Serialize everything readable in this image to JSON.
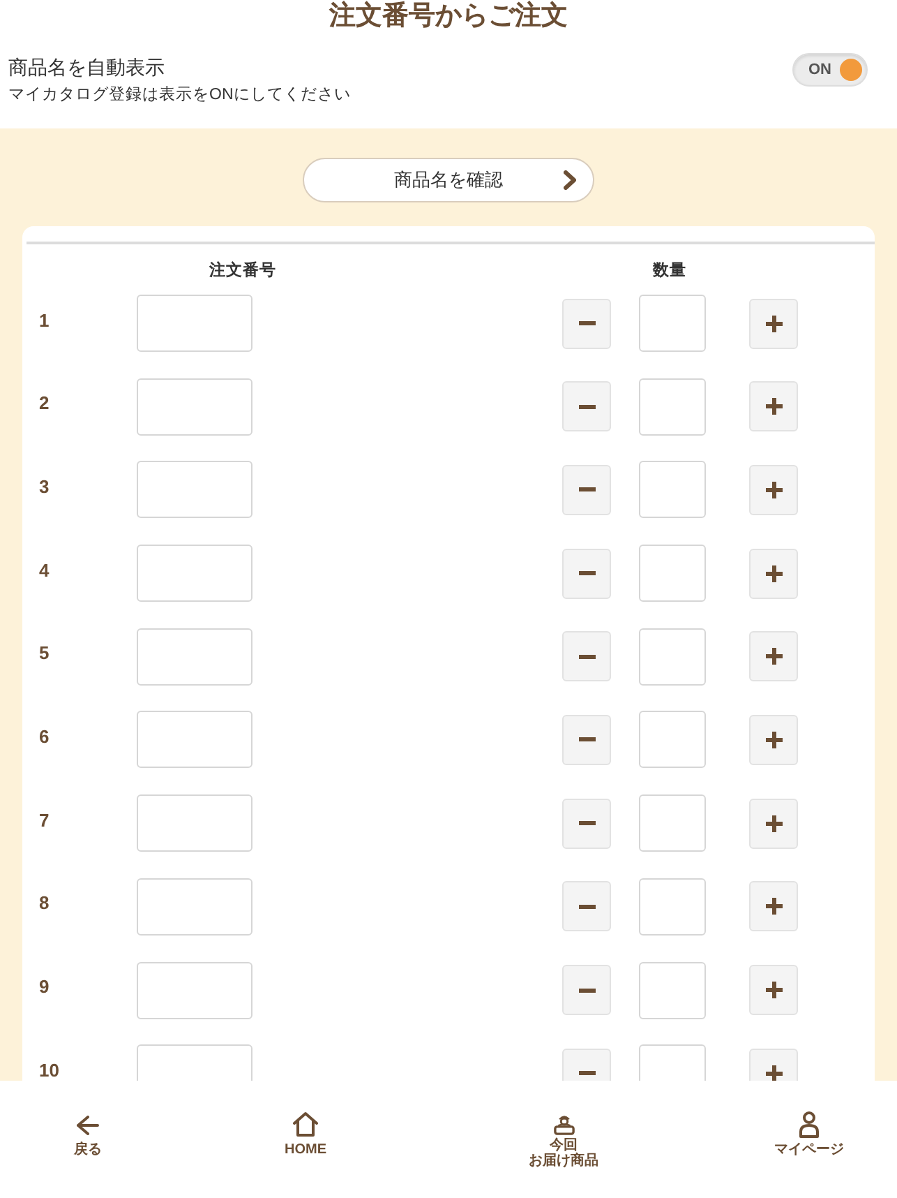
{
  "header": {
    "title": "注文番号からご注文"
  },
  "auto_display": {
    "label": "商品名を自動表示",
    "note": "マイカタログ登録は表示をONにしてください",
    "toggle": {
      "on": true,
      "label": "ON"
    }
  },
  "confirm_button": {
    "label": "商品名を確認"
  },
  "order_table": {
    "columns": [
      "注文番号",
      "数量"
    ],
    "rows": [
      {
        "number": "1"
      },
      {
        "number": "2"
      },
      {
        "number": "3"
      },
      {
        "number": "4"
      },
      {
        "number": "5"
      },
      {
        "number": "6"
      },
      {
        "number": "7"
      },
      {
        "number": "8"
      },
      {
        "number": "9"
      },
      {
        "number": "10"
      }
    ]
  },
  "bottom_nav": [
    {
      "label": "戻る"
    },
    {
      "label": "HOME"
    },
    {
      "caption": "今回",
      "label": "お届け商品"
    },
    {
      "label": "マイページ"
    }
  ]
}
